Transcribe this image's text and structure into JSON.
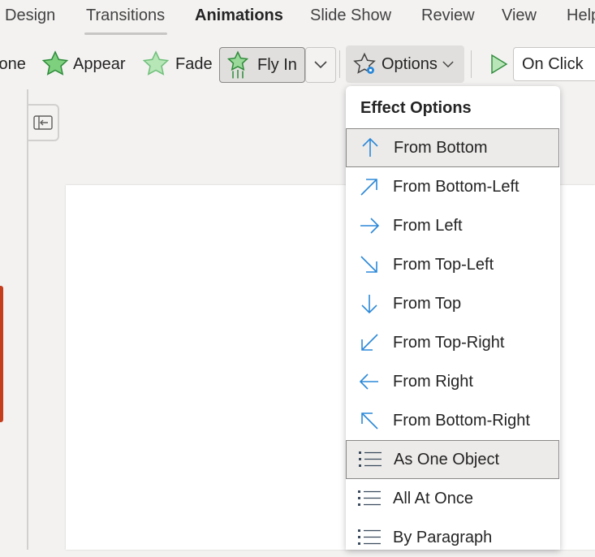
{
  "tabs": [
    "Design",
    "Transitions",
    "Animations",
    "Slide Show",
    "Review",
    "View",
    "Help"
  ],
  "toolbar": {
    "none_label": "None",
    "appear_label": "Appear",
    "fade_label": "Fade",
    "flyin_label": "Fly In",
    "options_label": "Options",
    "onclick_label": "On Click"
  },
  "menu": {
    "title": "Effect Options",
    "directions": [
      {
        "label": "From Bottom",
        "icon": "arrow-up-icon",
        "selected": true
      },
      {
        "label": "From Bottom-Left",
        "icon": "arrow-up-right-icon",
        "selected": false
      },
      {
        "label": "From Left",
        "icon": "arrow-right-icon",
        "selected": false
      },
      {
        "label": "From Top-Left",
        "icon": "arrow-down-right-icon",
        "selected": false
      },
      {
        "label": "From Top",
        "icon": "arrow-down-icon",
        "selected": false
      },
      {
        "label": "From Top-Right",
        "icon": "arrow-down-left-icon",
        "selected": false
      },
      {
        "label": "From Right",
        "icon": "arrow-left-icon",
        "selected": false
      },
      {
        "label": "From Bottom-Right",
        "icon": "arrow-up-left-icon",
        "selected": false
      }
    ],
    "sequence": [
      {
        "label": "As One Object",
        "icon": "list-icon",
        "selected": true
      },
      {
        "label": "All At Once",
        "icon": "list-icon",
        "selected": false
      },
      {
        "label": "By Paragraph",
        "icon": "list-icon",
        "selected": false
      }
    ]
  },
  "colors": {
    "accent_blue": "#2b88d8",
    "star_green": "#4caf50",
    "slide_accent": "#c43e1c"
  }
}
